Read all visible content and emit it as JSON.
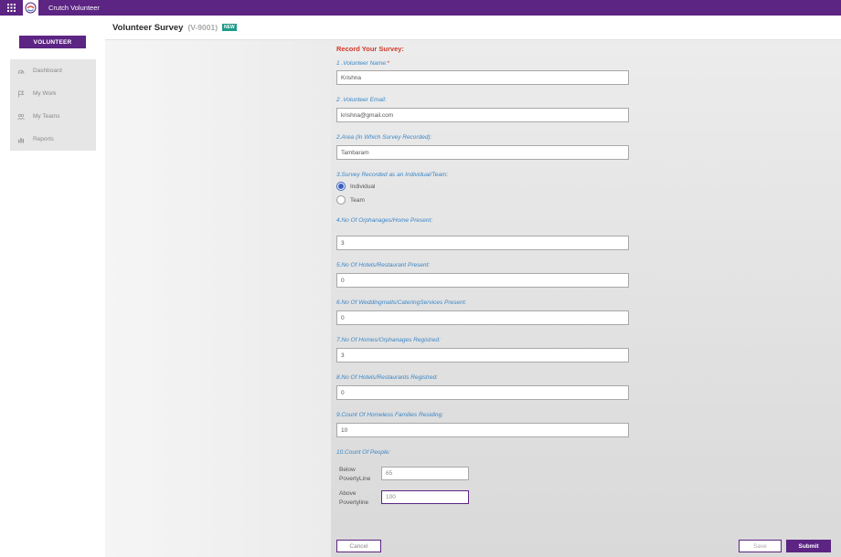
{
  "app": {
    "title": "Crutch Volunteer"
  },
  "sidebar": {
    "role_button": "VOLUNTEER",
    "items": [
      {
        "label": "Dashboard",
        "icon": "dashboard-icon"
      },
      {
        "label": "My Work",
        "icon": "flag-icon"
      },
      {
        "label": "My Teams",
        "icon": "team-icon"
      },
      {
        "label": "Reports",
        "icon": "bar-chart-icon"
      }
    ]
  },
  "header": {
    "title": "Volunteer Survey",
    "code": "(V-9001)",
    "badge": "NEW"
  },
  "form": {
    "heading": "Record Your Survey:",
    "q1": {
      "label": "1 .Volunteer Name:",
      "required_mark": "*",
      "value": "Krishna"
    },
    "q2": {
      "label": "2 .Volunteer Email:",
      "value": "krishna@gmail.com"
    },
    "q3": {
      "label": "2.Area (In Which Survey Recorded):",
      "value": "Tambaram"
    },
    "q4": {
      "label": "3.Survey Recorded as an Individual/Team:",
      "options": [
        "Individual",
        "Team"
      ],
      "selected": "Individual"
    },
    "q5": {
      "label": "4.No Of Orphanages/Home Present:",
      "value": "3"
    },
    "q6": {
      "label": "5.No Of Hotels/Restaurant Present:",
      "value": "0"
    },
    "q7": {
      "label": "6.No Of Weddingmalls/CateringServices Present:",
      "value": "0"
    },
    "q8": {
      "label": "7.No Of Homes/Orphanages Registred:",
      "value": "3"
    },
    "q9": {
      "label": "8.No Of Hotels/Restaurants Registred:",
      "value": "0"
    },
    "q10": {
      "label": "9.Count Of Homeless Families Residing:",
      "value": "10"
    },
    "q11": {
      "label": "10.Count Of People:",
      "below": {
        "label_line1": "Below",
        "label_line2": "PovertyLine",
        "value": "65"
      },
      "above": {
        "label_line1": "Above",
        "label_line2": "Povertyline",
        "value": "100"
      }
    }
  },
  "actions": {
    "cancel": "Cancel",
    "save": "Save",
    "submit": "Submit"
  },
  "colors": {
    "brand": "#5c2483",
    "label": "#3b86c6",
    "heading": "#d03a2a",
    "badge": "#1e9b8a"
  }
}
